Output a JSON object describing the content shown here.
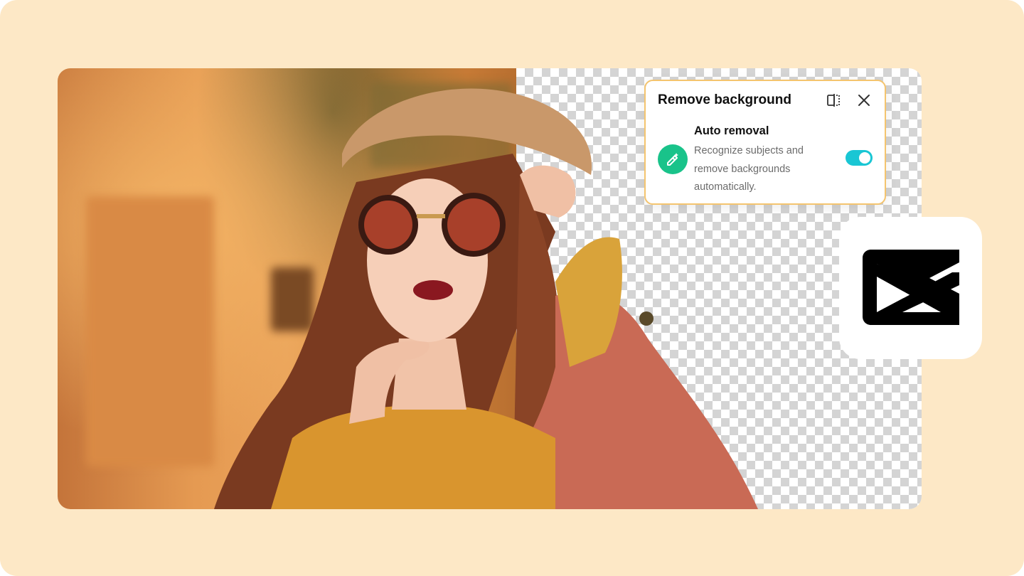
{
  "panel": {
    "title": "Remove background",
    "compare_icon": "compare-split-icon",
    "close_icon": "close-icon",
    "feature": {
      "icon": "magic-eraser-icon",
      "title": "Auto removal",
      "description": "Recognize subjects and remove backgrounds automatically.",
      "enabled": true
    }
  },
  "brand": {
    "logo": "capcut-logo",
    "accent_color": "#19c6d4",
    "feature_icon_color": "#19c38a",
    "panel_border_color": "#f4c46e",
    "background_color": "#fde8c6"
  }
}
